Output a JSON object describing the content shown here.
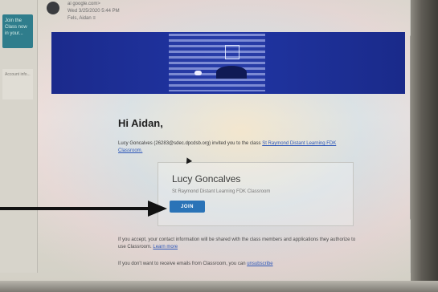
{
  "sidebar": {
    "card_text": "Join the Class now in your...",
    "card2_text": "Account info..."
  },
  "email_header": {
    "sender": "ai google.com>",
    "date": "Wed 3/25/2020 5:44 PM",
    "to": "Fels, Aidan ≡"
  },
  "email": {
    "greeting": "Hi Aidan,",
    "invite_text": "Lucy Goncalves (26283@sdec.dpcdsb.org) invited you to the class",
    "class_link": "St Raymond Distant Learning FDK Classroom.",
    "teacher_name": "Lucy Goncalves",
    "class_name": "St Raymond Distant Learning FDK Classroom",
    "join_label": "JOIN",
    "consent_text": "If you accept, your contact information will be shared with the class members and applications they authorize to use Classroom.",
    "learn_more": "Learn more",
    "unsubscribe_text": "If you don't want to receive emails from Classroom, you can",
    "unsubscribe_link": "unsubscribe"
  },
  "colors": {
    "banner": "#1b2a8c",
    "join_button": "#2a73b7",
    "link": "#2d57b8",
    "arrow": "#111111"
  },
  "icons": [
    "mouse-cursor-icon",
    "arrow-annotation-icon"
  ]
}
